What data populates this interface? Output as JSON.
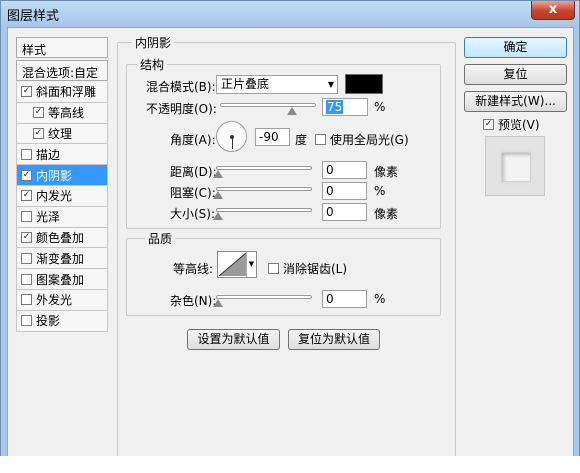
{
  "window": {
    "title": "图层样式",
    "close": "x"
  },
  "left": {
    "header": "样式",
    "blend_options": "混合选项:自定",
    "items": [
      {
        "label": "斜面和浮雕",
        "checked": "✓",
        "sub": false
      },
      {
        "label": "等高线",
        "checked": "✓",
        "sub": true
      },
      {
        "label": "纹理",
        "checked": "✓",
        "sub": true
      },
      {
        "label": "描边",
        "checked": "",
        "sub": false
      },
      {
        "label": "内阴影",
        "checked": "✓",
        "sub": false
      },
      {
        "label": "内发光",
        "checked": "✓",
        "sub": false
      },
      {
        "label": "光泽",
        "checked": "",
        "sub": false
      },
      {
        "label": "颜色叠加",
        "checked": "✓",
        "sub": false
      },
      {
        "label": "渐变叠加",
        "checked": "",
        "sub": false
      },
      {
        "label": "图案叠加",
        "checked": "",
        "sub": false
      },
      {
        "label": "外发光",
        "checked": "",
        "sub": false
      },
      {
        "label": "投影",
        "checked": "",
        "sub": false
      }
    ]
  },
  "inner_shadow": {
    "title": "内阴影",
    "structure": {
      "title": "结构",
      "blend_mode_label": "混合模式(B):",
      "blend_mode_value": "正片叠底",
      "swatch_color": "#000000",
      "opacity_label": "不透明度(O):",
      "opacity_value": "75",
      "opacity_unit": "%",
      "opacity_fraction": 0.75,
      "angle_label": "角度(A):",
      "angle_value": "-90",
      "angle_unit": "度",
      "global_light_label": "使用全局光(G)",
      "distance_label": "距离(D):",
      "distance_value": "0",
      "distance_unit": "像素",
      "choke_label": "阻塞(C):",
      "choke_value": "0",
      "choke_unit": "%",
      "size_label": "大小(S):",
      "size_value": "0",
      "size_unit": "像素"
    },
    "quality": {
      "title": "品质",
      "contour_label": "等高线:",
      "anti_alias_label": "消除锯齿(L)",
      "noise_label": "杂色(N):",
      "noise_value": "0",
      "noise_unit": "%"
    },
    "make_default": "设置为默认值",
    "reset_default": "复位为默认值"
  },
  "buttons": {
    "ok": "确定",
    "reset": "复位",
    "new_style": "新建样式(W)...",
    "preview_label": "预览(V)",
    "preview_checked": "✓"
  }
}
